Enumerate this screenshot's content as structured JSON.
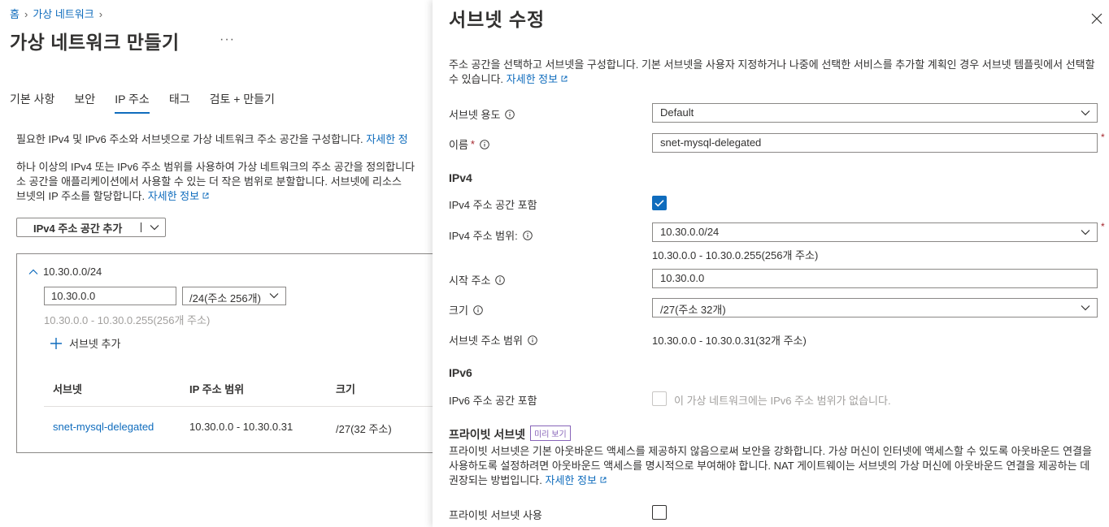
{
  "breadcrumb": {
    "home": "홈",
    "vnet": "가상 네트워크"
  },
  "page": {
    "title": "가상 네트워크 만들기",
    "more": "···"
  },
  "tabs": [
    {
      "label": "기본 사항"
    },
    {
      "label": "보안"
    },
    {
      "label": "IP 주소",
      "active": true
    },
    {
      "label": "태그"
    },
    {
      "label": "검토 + 만들기"
    }
  ],
  "left": {
    "intro_text": "필요한 IPv4 및 IPv6 주소와 서브넷으로 가상 네트워크 주소 공간을 구성합니다.",
    "intro_link": "자세한 정",
    "para_lines": [
      "하나 이상의 IPv4 또는 IPv6 주소 범위를 사용하여 가상 네트워크의 주소 공간을 정의합니다",
      "소 공간을 애플리케이션에서 사용할 수 있는 더 작은 범위로 분할합니다. 서브넷에 리소스",
      "브넷의 IP 주소를 할당합니다."
    ],
    "para_link": "자세한 정보",
    "add_space_button": "IPv4 주소 공간 추가",
    "address_space": {
      "cidr": "10.30.0.0/24",
      "start_value": "10.30.0.0",
      "size_value": "/24(주소 256개)",
      "range_hint": "10.30.0.0 - 10.30.0.255(256개 주소)",
      "add_subnet": "서브넷 추가"
    },
    "table": {
      "headers": [
        "서브넷",
        "IP 주소 범위",
        "크기"
      ],
      "rows": [
        {
          "name": "snet-mysql-delegated",
          "range": "10.30.0.0 - 10.30.0.31",
          "size": "/27(32 주소)"
        }
      ]
    }
  },
  "panel": {
    "title": "서브넷 수정",
    "description": "주소 공간을 선택하고 서브넷을 구성합니다. 기본 서브넷을 사용자 지정하거나 나중에 선택한 서비스를 추가할 계획인 경우 서브넷 템플릿에서 선택할 수 있습니다.",
    "description_link": "자세한 정보",
    "purpose_label": "서브넷 용도",
    "purpose_value": "Default",
    "name_label": "이름",
    "required_mark": "*",
    "name_value": "snet-mysql-delegated",
    "ipv4_section": "IPv4",
    "ipv4_include_label": "IPv4 주소 공간 포함",
    "ipv4_include_checked": true,
    "ipv4_range_label": "IPv4 주소 범위:",
    "ipv4_range_value": "10.30.0.0/24",
    "ipv4_range_hint": "10.30.0.0 - 10.30.0.255(256개 주소)",
    "start_label": "시작 주소",
    "start_value": "10.30.0.0",
    "size_label": "크기",
    "size_value": "/27(주소 32개)",
    "subnet_range_label": "서브넷 주소 범위",
    "subnet_range_value": "10.30.0.0 - 10.30.0.31(32개 주소)",
    "ipv6_section": "IPv6",
    "ipv6_include_label": "IPv6 주소 공간 포함",
    "ipv6_include_checked": false,
    "ipv6_note": "이 가상 네트워크에는 IPv6 주소 범위가 없습니다.",
    "private_section": "프라이빗 서브넷",
    "preview_badge": "미리 보기",
    "private_description": "프라이빗 서브넷은 기본 아웃바운드 액세스를 제공하지 않음으로써 보안을 강화합니다. 가상 머신이 인터넷에 액세스할 수 있도록 아웃바운드 연결을 사용하도록 설정하려면 아웃바운드 액세스를 명시적으로 부여해야 합니다. NAT 게이트웨이는 서브넷의 가상 머신에 아웃바운드 연결을 제공하는 데 권장되는 방법입니다.",
    "private_link": "자세한 정보",
    "private_enable_label": "프라이빗 서브넷 사용",
    "private_enable_checked": false
  },
  "colors": {
    "accent": "#0f6cbd",
    "required": "#a4262c",
    "preview": "#8764b8"
  }
}
